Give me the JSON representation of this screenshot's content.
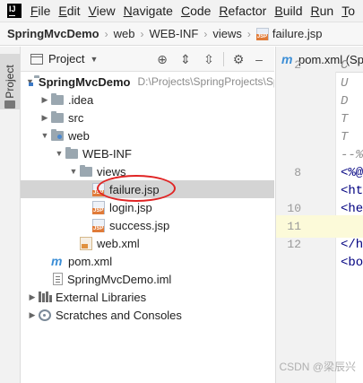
{
  "menubar": {
    "logo": "IJ",
    "items": [
      {
        "first": "F",
        "rest": "ile"
      },
      {
        "first": "E",
        "rest": "dit"
      },
      {
        "first": "V",
        "rest": "iew"
      },
      {
        "first": "N",
        "rest": "avigate"
      },
      {
        "first": "C",
        "rest": "ode"
      },
      {
        "first": "R",
        "rest": "efactor"
      },
      {
        "first": "B",
        "rest": "uild"
      },
      {
        "first": "R",
        "rest": "un"
      },
      {
        "first": "T",
        "rest": "o"
      }
    ]
  },
  "breadcrumb": [
    "SpringMvcDemo",
    "web",
    "WEB-INF",
    "views",
    "failure.jsp"
  ],
  "stripe": {
    "label": "Project"
  },
  "panel": {
    "title": "Project"
  },
  "tree": {
    "root": {
      "name": "SpringMvcDemo",
      "path": "D:\\Projects\\SpringProjects\\SpringMVCDe"
    },
    "idea": ".idea",
    "src": "src",
    "web": "web",
    "webinf": "WEB-INF",
    "views": "views",
    "failure": "failure.jsp",
    "login": "login.jsp",
    "success": "success.jsp",
    "webxml": "web.xml",
    "pom": "pom.xml",
    "iml": "SpringMvcDemo.iml",
    "extlib": "External Libraries",
    "scratches": "Scratches and Consoles"
  },
  "editor": {
    "tab": "pom.xml (Sp",
    "lines": [
      {
        "n": "2",
        "text": "C",
        "style": "ital"
      },
      {
        "n": "",
        "text": "U",
        "style": "ital"
      },
      {
        "n": "",
        "text": "D",
        "style": "ital"
      },
      {
        "n": "",
        "text": "T",
        "style": "ital"
      },
      {
        "n": "",
        "text": "T",
        "style": "ital"
      },
      {
        "n": "",
        "text": "--%",
        "style": "ital"
      },
      {
        "n": "8",
        "text": "<%@",
        "style": "tag"
      },
      {
        "n": "",
        "text": "<ht",
        "style": "tag"
      },
      {
        "n": "10",
        "text": "<he",
        "style": "tag"
      },
      {
        "n": "11",
        "text": "",
        "style": "plain"
      },
      {
        "n": "12",
        "text": "</h",
        "style": "tag"
      },
      {
        "n": "",
        "text": "<bo",
        "style": "tag"
      }
    ]
  },
  "watermark": "CSDN @梁辰兴"
}
